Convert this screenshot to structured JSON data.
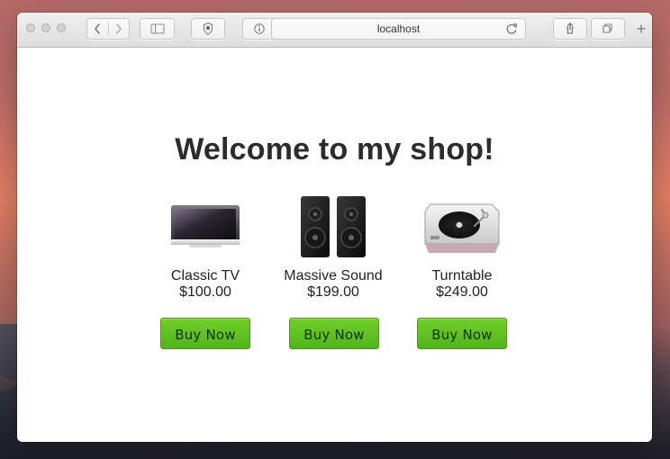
{
  "browser": {
    "address_text": "localhost",
    "new_tab_label": "+",
    "icons": {
      "back": "chevron-left-icon",
      "forward": "chevron-right-icon",
      "sidebar": "sidebar-icon",
      "shield": "shield-icon",
      "info": "info-icon",
      "reload": "reload-icon",
      "share": "share-icon",
      "tabs": "tabs-icon"
    }
  },
  "page": {
    "title": "Welcome to my shop!",
    "products": [
      {
        "name": "Classic TV",
        "price": "$100.00",
        "button_label": "Buy Now",
        "image_icon": "tv-icon"
      },
      {
        "name": "Massive Sound",
        "price": "$199.00",
        "button_label": "Buy Now",
        "image_icon": "speakers-icon"
      },
      {
        "name": "Turntable",
        "price": "$249.00",
        "button_label": "Buy Now",
        "image_icon": "turntable-icon"
      }
    ]
  },
  "colors": {
    "accent_green": "#5eb923",
    "text_dark": "#222222"
  }
}
